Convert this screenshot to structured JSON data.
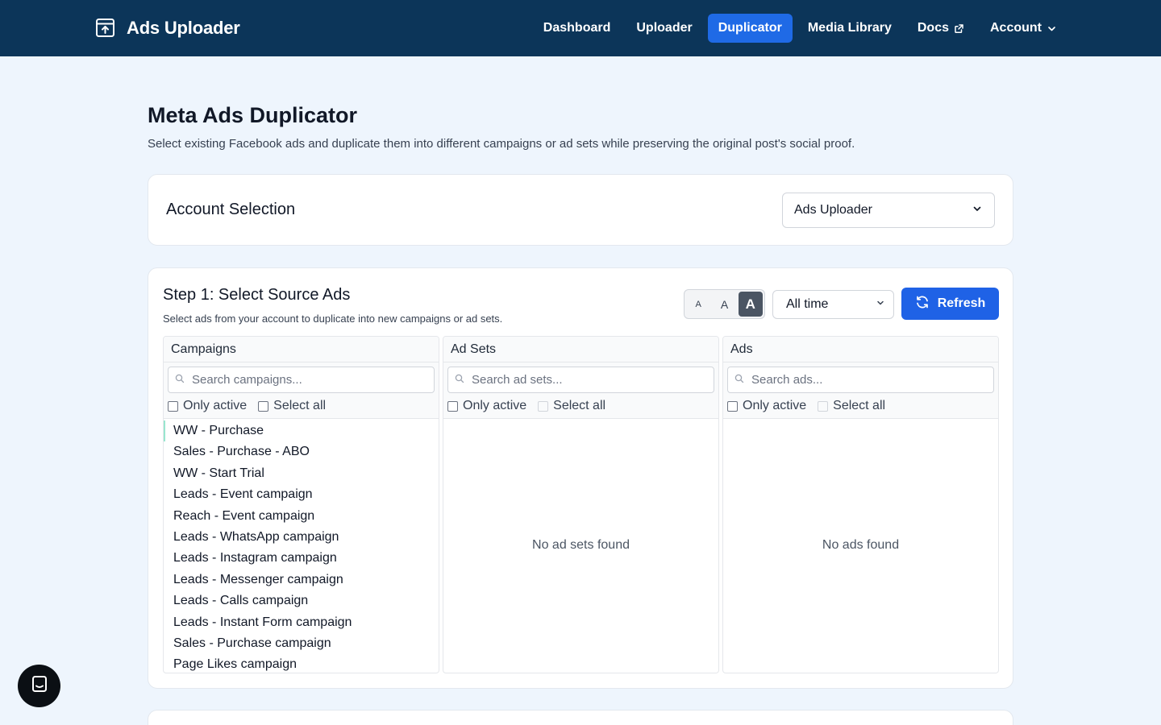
{
  "app": {
    "name": "Ads Uploader"
  },
  "nav": {
    "items": [
      {
        "label": "Dashboard"
      },
      {
        "label": "Uploader"
      },
      {
        "label": "Duplicator"
      },
      {
        "label": "Media Library"
      },
      {
        "label": "Docs"
      },
      {
        "label": "Account"
      }
    ],
    "active": "Duplicator"
  },
  "page": {
    "title": "Meta Ads Duplicator",
    "subtitle": "Select existing Facebook ads and duplicate them into different campaigns or ad sets while preserving the original post's social proof."
  },
  "account": {
    "title": "Account Selection",
    "selected": "Ads Uploader"
  },
  "step1": {
    "title": "Step 1: Select Source Ads",
    "subtitle": "Select ads from your account to duplicate into new campaigns or ad sets.",
    "size_labels": [
      "A",
      "A",
      "A"
    ],
    "time_range": "All time",
    "refresh_label": "Refresh",
    "columns": {
      "campaigns": {
        "header": "Campaigns",
        "search_placeholder": "Search campaigns...",
        "only_active": "Only active",
        "select_all": "Select all",
        "items": [
          "WW - Purchase",
          "Sales - Purchase - ABO",
          "WW - Start Trial",
          "Leads - Event campaign",
          "Reach - Event campaign",
          "Leads - WhatsApp campaign",
          "Leads - Instagram campaign",
          "Leads - Messenger campaign",
          "Leads - Calls campaign",
          "Leads - Instant Form campaign",
          "Sales - Purchase campaign",
          "Page Likes campaign"
        ]
      },
      "adsets": {
        "header": "Ad Sets",
        "search_placeholder": "Search ad sets...",
        "only_active": "Only active",
        "select_all": "Select all",
        "empty": "No ad sets found"
      },
      "ads": {
        "header": "Ads",
        "search_placeholder": "Search ads...",
        "only_active": "Only active",
        "select_all": "Select all",
        "empty": "No ads found"
      }
    }
  },
  "colors": {
    "nav_bg": "#0c3559",
    "accent": "#1f6ae6",
    "page_bg": "#eef5fd"
  },
  "icons": {
    "brand": "upload-box-icon",
    "external": "external-link-icon",
    "chevron": "chevron-down-icon",
    "refresh": "refresh-icon",
    "search": "search-icon",
    "chat": "chat-icon"
  }
}
